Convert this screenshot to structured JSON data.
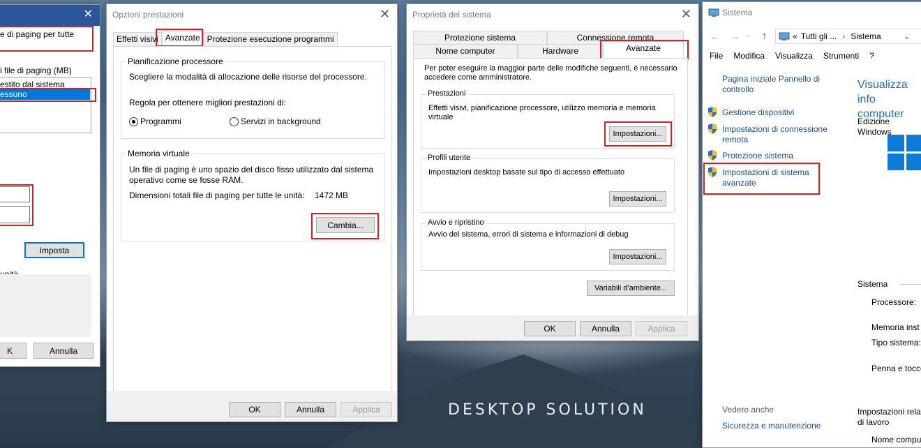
{
  "watermark": "DESKTOP SOLUTION",
  "w1": {
    "line1": "e di paging per tutte",
    "list_header": "i file di paging (MB)",
    "row1": "estito dal sistema",
    "row2": "essuno",
    "set_button": "Imposta",
    "units_label": "unità",
    "ok_button": "K",
    "cancel_button": "Annulla"
  },
  "w2": {
    "title": "Opzioni prestazioni",
    "tabs": [
      "Effetti visivi",
      "Avanzate",
      "Protezione esecuzione programmi"
    ],
    "cpu_group": "Pianificazione processore",
    "cpu_desc": "Scegliere la modalità di allocazione delle risorse del processore.",
    "cpu_prompt": "Regola per ottenere migliori prestazioni di:",
    "radio_programs": "Programmi",
    "radio_background": "Servizi in background",
    "vm_group": "Memoria virtuale",
    "vm_desc1": "Un file di paging è uno spazio del disco fisso utilizzato dal sistema",
    "vm_desc2": "operativo come se fosse RAM.",
    "vm_total_label": "Dimensioni totali file di paging per tutte le unità:",
    "vm_total_value": "1472 MB",
    "change_button": "Cambia...",
    "ok": "OK",
    "cancel": "Annulla",
    "apply": "Applica"
  },
  "w3": {
    "title": "Proprietà del sistema",
    "tabs_top": [
      "Protezione sistema",
      "Connessione remota"
    ],
    "tabs_bottom": [
      "Nome computer",
      "Hardware",
      "Avanzate"
    ],
    "admin_note1": "Per poter eseguire la maggior parte delle modifiche seguenti, è necessario",
    "admin_note2": "accedere come amministratore.",
    "perf_group": "Prestazioni",
    "perf_desc1": "Effetti visivi, pianificazione processore, utilizzo memoria e memoria",
    "perf_desc2": "virtuale",
    "profiles_group": "Profili utente",
    "profiles_desc": "Impostazioni desktop basate sul tipo di accesso effettuato",
    "startup_group": "Avvio e ripristino",
    "startup_desc": "Avvio del sistema, errori di sistema e informazioni di debug",
    "settings_button": "Impostazioni...",
    "env_button": "Variabili d'ambiente...",
    "ok": "OK",
    "cancel": "Annulla",
    "apply": "Applica"
  },
  "w4": {
    "title": "Sistema",
    "address_prefix": "«",
    "address_part1": "Tutti gli ...",
    "address_sep": "›",
    "address_part2": "Sistema",
    "menu": [
      "File",
      "Modifica",
      "Visualizza",
      "Strumenti",
      "?"
    ],
    "home_link1": "Pagina iniziale Pannello di",
    "home_link2": "controllo",
    "links": [
      [
        "Gestione dispositivi"
      ],
      [
        "Impostazioni di connessione",
        "remota"
      ],
      [
        "Protezione sistema"
      ],
      [
        "Impostazioni di sistema",
        "avanzate"
      ]
    ],
    "heading1": "Visualizza info",
    "heading2": "computer",
    "edition": "Edizione Windows",
    "system_label": "Sistema",
    "processor": "Processore:",
    "memory": "Memoria inst",
    "system_type": "Tipo sistema:",
    "pen": "Penna e tocco",
    "see_also": "Vedere anche",
    "security_link": "Sicurezza e manutenzione",
    "related1": "Impostazioni relat",
    "related2": "di lavoro",
    "computer_name": "Nome compu"
  }
}
